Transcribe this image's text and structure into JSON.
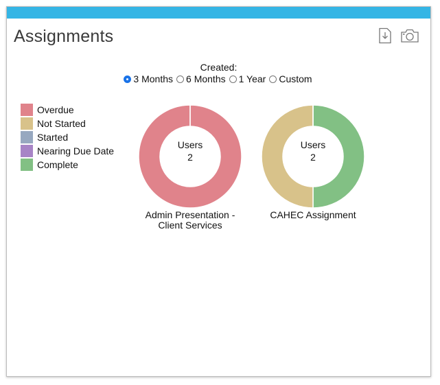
{
  "widget": {
    "title": "Assignments",
    "actions": [
      {
        "name": "download-icon"
      },
      {
        "name": "camera-icon"
      }
    ]
  },
  "filter": {
    "label": "Created:",
    "options": [
      "3 Months",
      "6 Months",
      "1 Year",
      "Custom"
    ],
    "selected": "3 Months"
  },
  "legend": [
    {
      "label": "Overdue",
      "color": "#e0838b"
    },
    {
      "label": "Not Started",
      "color": "#d8c28a"
    },
    {
      "label": "Started",
      "color": "#97a8c0"
    },
    {
      "label": "Nearing Due Date",
      "color": "#a784c6"
    },
    {
      "label": "Complete",
      "color": "#82c084"
    }
  ],
  "chart_data": [
    {
      "type": "pie",
      "center_label": "Users",
      "total": "2",
      "caption": [
        "Admin Presentation -",
        "Client Services"
      ],
      "slices": [
        {
          "name": "Overdue",
          "value": 2,
          "color": "#e0838b"
        }
      ]
    },
    {
      "type": "pie",
      "center_label": "Users",
      "total": "2",
      "caption": [
        "CAHEC Assignment"
      ],
      "slices": [
        {
          "name": "Complete",
          "value": 1,
          "color": "#82c084"
        },
        {
          "name": "Not Started",
          "value": 1,
          "color": "#d8c28a"
        }
      ]
    }
  ]
}
